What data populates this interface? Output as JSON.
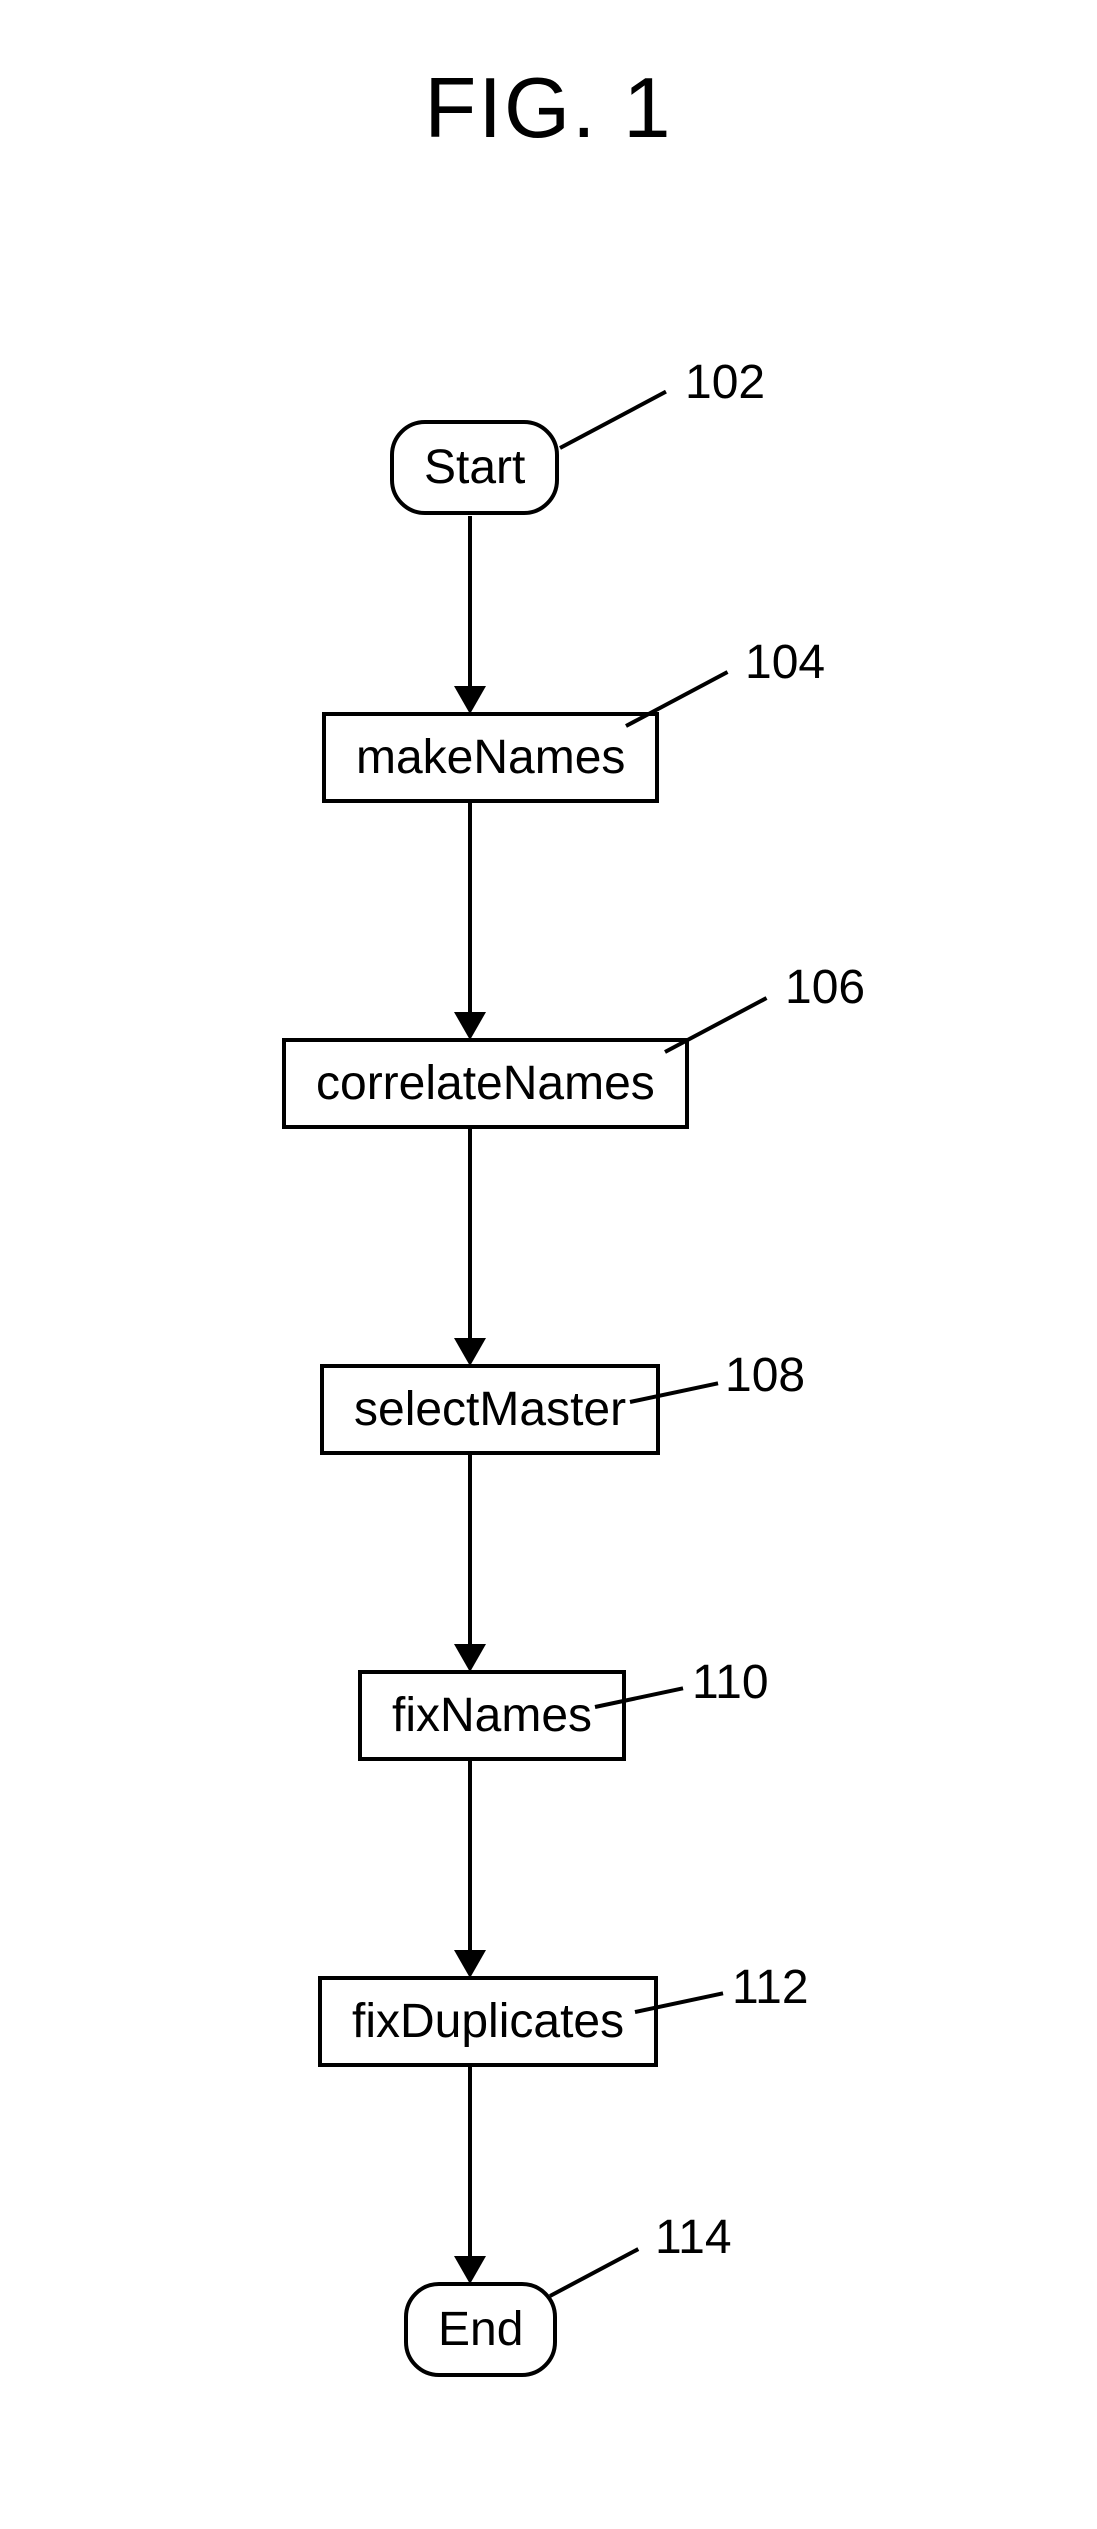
{
  "title": "FIG. 1",
  "nodes": {
    "start": {
      "label": "Start",
      "ref": "102"
    },
    "makeNames": {
      "label": "makeNames",
      "ref": "104"
    },
    "correlateNames": {
      "label": "correlateNames",
      "ref": "106"
    },
    "selectMaster": {
      "label": "selectMaster",
      "ref": "108"
    },
    "fixNames": {
      "label": "fixNames",
      "ref": "110"
    },
    "fixDuplicates": {
      "label": "fixDuplicates",
      "ref": "112"
    },
    "end": {
      "label": "End",
      "ref": "114"
    }
  }
}
